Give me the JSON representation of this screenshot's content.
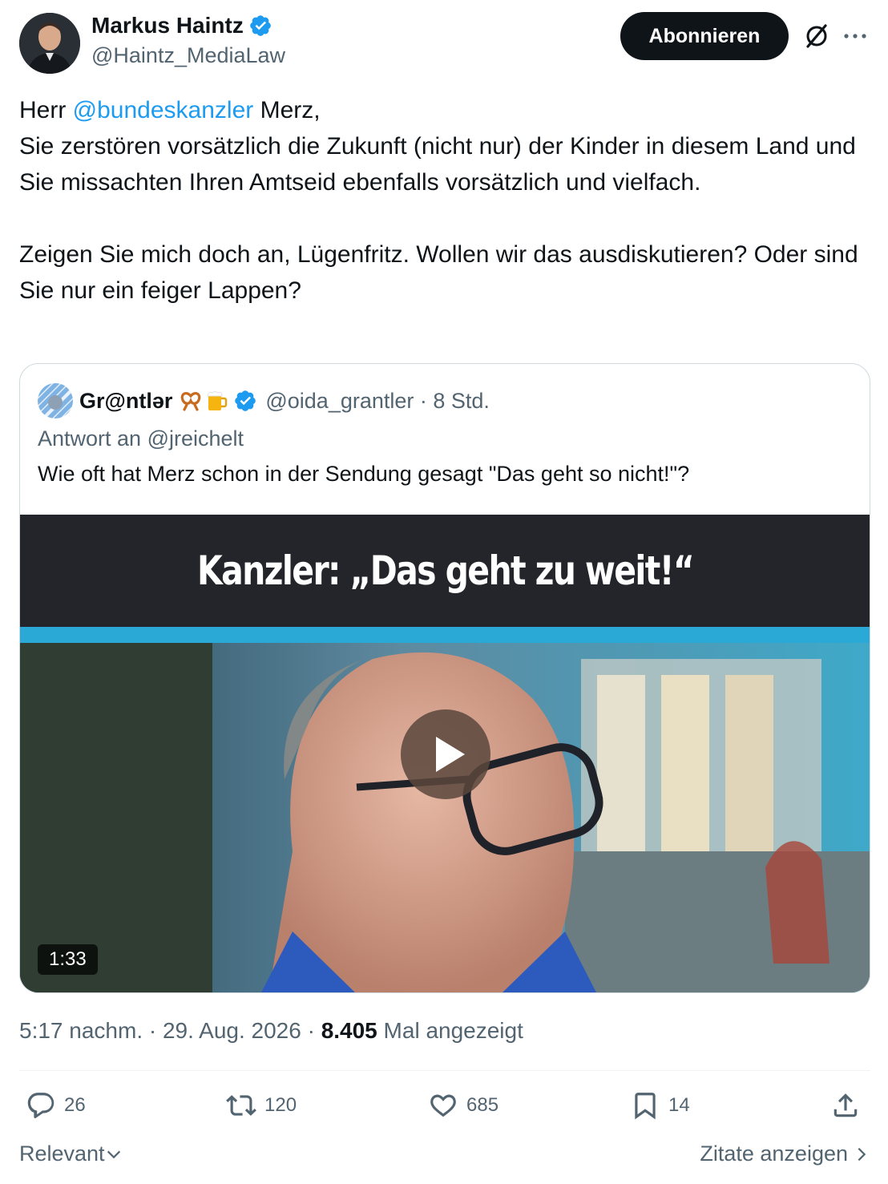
{
  "author": {
    "name": "Markus Haintz",
    "handle": "@Haintz_MediaLaw"
  },
  "follow_label": "Abonnieren",
  "tweet": {
    "line1_prefix": "Herr ",
    "line1_mention": "@bundeskanzler",
    "line1_suffix": " Merz,",
    "paragraph1_rest": "Sie zerstören vorsätzlich die Zukunft (nicht nur) der Kinder in diesem Land und Sie missachten Ihren Amtseid ebenfalls vorsätzlich und vielfach.",
    "paragraph2": "Zeigen Sie mich doch an, Lügenfritz. Wollen wir das ausdiskutieren? Oder sind Sie nur ein feiger Lappen?"
  },
  "quote": {
    "name": "Gr@ntlər",
    "handle_time": "@oida_grantler · 8 Std.",
    "reply_to": "Antwort an @jreichelt",
    "text": "Wie oft hat Merz schon in der Sendung gesagt \"Das geht so nicht!\"?",
    "video": {
      "banner": "Kanzler: „Das geht zu weit!“",
      "duration": "1:33"
    }
  },
  "meta": {
    "time_date": "5:17 nachm. · 29. Aug. 2026 · ",
    "views": "8.405",
    "views_label": " Mal angezeigt"
  },
  "actions": {
    "replies": "26",
    "reposts": "120",
    "likes": "685",
    "bookmarks": "14"
  },
  "footer": {
    "sort_label": "Relevant",
    "quotes_label": "Zitate anzeigen"
  },
  "colors": {
    "link": "#1d9bf0",
    "text": "#0f1419",
    "secondary": "#536471",
    "verified": "#1d9bf0"
  },
  "icons": [
    "verified-badge-icon",
    "grok-icon",
    "more-icon",
    "play-icon",
    "reply-icon",
    "repost-icon",
    "like-icon",
    "bookmark-icon",
    "share-icon",
    "chevron-down-icon",
    "chevron-right-icon"
  ]
}
